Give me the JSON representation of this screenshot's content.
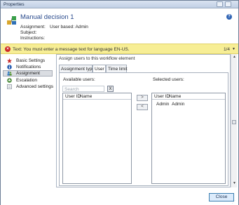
{
  "window": {
    "title": "Properties"
  },
  "header": {
    "title": "Manual decision 1",
    "assignment_label": "Assignment:",
    "assignment_value": "User based: Admin",
    "subject_label": "Subject:",
    "instructions_label": "Instructions:",
    "help_glyph": "?"
  },
  "warning": {
    "icon_glyph": "×",
    "text": "Text: You must enter a message text for language EN-US.",
    "pager": "1/4",
    "arrow_glyph": "▼"
  },
  "nav": {
    "items": [
      {
        "label": "Basic Settings",
        "icon": "star-icon"
      },
      {
        "label": "Notifications",
        "icon": "info-icon"
      },
      {
        "label": "Assignment",
        "icon": "users-icon",
        "selected": true
      },
      {
        "label": "Escalation",
        "icon": "escalation-icon"
      },
      {
        "label": "Advanced settings",
        "icon": "settings-icon"
      }
    ]
  },
  "panel": {
    "title": "Assign users to this workflow element",
    "tabs": [
      {
        "label": "Assignment type"
      },
      {
        "label": "User",
        "active": true
      },
      {
        "label": "Time limit"
      }
    ],
    "available": {
      "label": "Available users:",
      "search_placeholder": "Search",
      "clear_glyph": "X",
      "columns": [
        "User ID",
        "Name"
      ],
      "rows": []
    },
    "add_glyph": ">",
    "remove_glyph": "<",
    "selected": {
      "label": "Selected users:",
      "columns": [
        "User ID",
        "Name"
      ],
      "rows": [
        {
          "user_id": "Admin",
          "name": "Admin"
        }
      ]
    }
  },
  "scrollbar": {
    "up_glyph": "▲",
    "down_glyph": "▼"
  },
  "footer": {
    "close_label": "Close",
    "grip_glyph": "⋰"
  },
  "colors": {
    "accent": "#2a4b8d",
    "warning_bg": "#f7ee95",
    "error": "#cc2a2a"
  }
}
